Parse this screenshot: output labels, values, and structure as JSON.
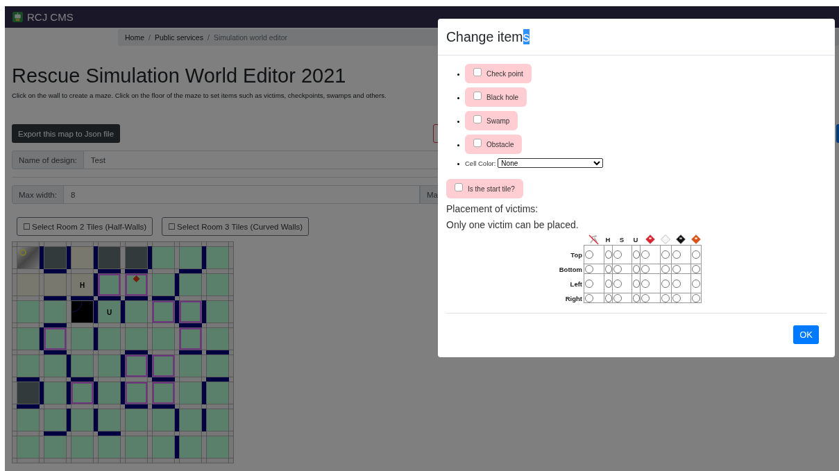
{
  "navbar": {
    "brand": "RCJ CMS"
  },
  "breadcrumb": [
    {
      "label": "Home",
      "active": false
    },
    {
      "label": "Public services",
      "active": false,
      "separator": "/"
    },
    {
      "label": "Simulation world editor",
      "active": true,
      "separator": "/"
    }
  ],
  "title": "Rescue Simulation World Editor 2021",
  "description": "Click on the wall to create a maze. Click on the floor of the maze to set items such as victims, checkpoints, swamps and others.",
  "toolbar": [
    {
      "kind": "dark",
      "label": "Export this map to Json file"
    },
    {
      "kind": "danger-outline"
    },
    {
      "kind": "primary"
    }
  ],
  "design_field": {
    "label": "Name of design:",
    "value": "Test"
  },
  "size_fields": [
    {
      "label": "Max width:",
      "value": "8"
    },
    {
      "label": "Ma"
    }
  ],
  "room_buttons": [
    {
      "icon": "☐",
      "label": "Select Room 2 Tiles (Half-Walls)"
    },
    {
      "icon": "☐",
      "label": "Select Room 3 Tiles (Curved Walls)"
    }
  ],
  "maze": {
    "rows": [
      {
        "tiles": [
          {
            "kind": "start",
            "outlined": false,
            "wall_right": true,
            "wall_bottom": false
          },
          {
            "kind": "dark",
            "outlined": false,
            "wall_right": true,
            "wall_bottom": true
          },
          {
            "kind": "light",
            "outlined": false,
            "wall_right": true,
            "wall_bottom": false
          },
          {
            "kind": "dark",
            "outlined": false,
            "wall_right": false,
            "wall_bottom": true
          },
          {
            "kind": "dark",
            "outlined": false,
            "wall_right": true,
            "wall_bottom": true
          },
          {
            "kind": "green",
            "outlined": false,
            "wall_right": false,
            "wall_bottom": false
          },
          {
            "kind": "green",
            "outlined": false,
            "wall_right": true,
            "wall_bottom": true
          },
          {
            "kind": "green",
            "outlined": false,
            "wall_right": false,
            "wall_bottom": false
          }
        ]
      },
      {
        "tiles": [
          {
            "kind": "light",
            "outlined": false,
            "wall_right": false,
            "wall_bottom": false
          },
          {
            "kind": "light",
            "outlined": false,
            "wall_right": false,
            "wall_bottom": true
          },
          {
            "kind": "light",
            "outlined": false,
            "wall_right": true,
            "wall_bottom": true,
            "marker": {
              "kind": "letter",
              "text": "H"
            }
          },
          {
            "kind": "green",
            "outlined": true,
            "wall_right": false,
            "wall_bottom": true
          },
          {
            "kind": "green",
            "outlined": true,
            "wall_right": false,
            "wall_bottom": true,
            "marker": {
              "kind": "hazmat"
            }
          },
          {
            "kind": "green",
            "outlined": false,
            "wall_right": true,
            "wall_bottom": true
          },
          {
            "kind": "green",
            "outlined": false,
            "wall_right": false,
            "wall_bottom": false
          },
          {
            "kind": "green",
            "outlined": false,
            "wall_right": false,
            "wall_bottom": false
          }
        ]
      },
      {
        "tiles": [
          {
            "kind": "green",
            "outlined": false,
            "wall_right": false,
            "wall_bottom": false
          },
          {
            "kind": "green",
            "outlined": false,
            "wall_right": false,
            "wall_bottom": true
          },
          {
            "kind": "curved",
            "outlined": false,
            "wall_right": true,
            "wall_bottom": false
          },
          {
            "kind": "green",
            "outlined": false,
            "wall_right": true,
            "wall_bottom": false,
            "marker": {
              "kind": "letter",
              "text": "U"
            }
          },
          {
            "kind": "green",
            "outlined": false,
            "wall_right": false,
            "wall_bottom": false
          },
          {
            "kind": "green",
            "outlined": true,
            "wall_right": true,
            "wall_bottom": false
          },
          {
            "kind": "green",
            "outlined": true,
            "wall_right": true,
            "wall_bottom": true
          },
          {
            "kind": "green",
            "outlined": false,
            "wall_right": false,
            "wall_bottom": false
          }
        ]
      },
      {
        "tiles": [
          {
            "kind": "green",
            "outlined": false,
            "wall_right": true,
            "wall_bottom": false
          },
          {
            "kind": "green",
            "outlined": true,
            "wall_right": false,
            "wall_bottom": true
          },
          {
            "kind": "green",
            "outlined": false,
            "wall_right": true,
            "wall_bottom": false
          },
          {
            "kind": "green",
            "outlined": false,
            "wall_right": false,
            "wall_bottom": false
          },
          {
            "kind": "green",
            "outlined": false,
            "wall_right": false,
            "wall_bottom": true
          },
          {
            "kind": "green",
            "outlined": false,
            "wall_right": false,
            "wall_bottom": false
          },
          {
            "kind": "green",
            "outlined": true,
            "wall_right": false,
            "wall_bottom": true
          },
          {
            "kind": "green",
            "outlined": false,
            "wall_right": false,
            "wall_bottom": true
          }
        ]
      },
      {
        "tiles": [
          {
            "kind": "green",
            "outlined": false,
            "wall_right": false,
            "wall_bottom": true
          },
          {
            "kind": "green",
            "outlined": false,
            "wall_right": true,
            "wall_bottom": false
          },
          {
            "kind": "green",
            "outlined": false,
            "wall_right": false,
            "wall_bottom": true
          },
          {
            "kind": "green",
            "outlined": false,
            "wall_right": true,
            "wall_bottom": false
          },
          {
            "kind": "green",
            "outlined": true,
            "wall_right": true,
            "wall_bottom": false
          },
          {
            "kind": "green",
            "outlined": true,
            "wall_right": false,
            "wall_bottom": true
          },
          {
            "kind": "green",
            "outlined": false,
            "wall_right": false,
            "wall_bottom": false
          },
          {
            "kind": "green",
            "outlined": false,
            "wall_right": false,
            "wall_bottom": true
          }
        ]
      },
      {
        "tiles": [
          {
            "kind": "dark",
            "outlined": false,
            "wall_right": true,
            "wall_bottom": true
          },
          {
            "kind": "green",
            "outlined": false,
            "wall_right": true,
            "wall_bottom": false
          },
          {
            "kind": "green",
            "outlined": true,
            "wall_right": true,
            "wall_bottom": false
          },
          {
            "kind": "green",
            "outlined": false,
            "wall_right": true,
            "wall_bottom": false
          },
          {
            "kind": "green",
            "outlined": true,
            "wall_right": false,
            "wall_bottom": true
          },
          {
            "kind": "green",
            "outlined": true,
            "wall_right": false,
            "wall_bottom": true
          },
          {
            "kind": "green",
            "outlined": false,
            "wall_right": true,
            "wall_bottom": false
          },
          {
            "kind": "green",
            "outlined": false,
            "wall_right": false,
            "wall_bottom": false
          }
        ]
      },
      {
        "tiles": [
          {
            "kind": "green",
            "outlined": false,
            "wall_right": false,
            "wall_bottom": false
          },
          {
            "kind": "green",
            "outlined": false,
            "wall_right": true,
            "wall_bottom": true
          },
          {
            "kind": "green",
            "outlined": false,
            "wall_right": true,
            "wall_bottom": false
          },
          {
            "kind": "green",
            "outlined": false,
            "wall_right": false,
            "wall_bottom": true
          },
          {
            "kind": "green",
            "outlined": false,
            "wall_right": false,
            "wall_bottom": false
          },
          {
            "kind": "green",
            "outlined": false,
            "wall_right": true,
            "wall_bottom": false
          },
          {
            "kind": "green",
            "outlined": false,
            "wall_right": true,
            "wall_bottom": false
          },
          {
            "kind": "green",
            "outlined": false,
            "wall_right": false,
            "wall_bottom": false
          }
        ]
      },
      {
        "tiles": [
          {
            "kind": "green",
            "outlined": false,
            "wall_right": false,
            "wall_bottom": false
          },
          {
            "kind": "green",
            "outlined": false,
            "wall_right": false,
            "wall_bottom": false
          },
          {
            "kind": "green",
            "outlined": false,
            "wall_right": false,
            "wall_bottom": false
          },
          {
            "kind": "green",
            "outlined": false,
            "wall_right": false,
            "wall_bottom": false
          },
          {
            "kind": "green",
            "outlined": false,
            "wall_right": false,
            "wall_bottom": false
          },
          {
            "kind": "green",
            "outlined": false,
            "wall_right": true,
            "wall_bottom": false
          },
          {
            "kind": "green",
            "outlined": false,
            "wall_right": false,
            "wall_bottom": false
          },
          {
            "kind": "green",
            "outlined": false,
            "wall_right": false,
            "wall_bottom": false
          }
        ]
      }
    ]
  },
  "modal": {
    "title": "Change item",
    "title_selection": "s",
    "items": [
      {
        "label": "Check point",
        "checked": false
      },
      {
        "label": "Black hole",
        "checked": false
      },
      {
        "label": "Swamp",
        "checked": false
      },
      {
        "label": "Obstacle",
        "checked": false
      }
    ],
    "cell_color": {
      "label": "Cell Color:",
      "value": "None"
    },
    "start_tile": {
      "label": "Is the start tile?",
      "checked": false
    },
    "victims_heading": "Placement of victims:",
    "victims_note": "Only one victim can be placed.",
    "victim_columns": [
      {
        "kind": "harmed"
      },
      {
        "kind": "letter",
        "text": "H"
      },
      {
        "kind": "letter",
        "text": "S"
      },
      {
        "kind": "letter",
        "text": "U"
      },
      {
        "kind": "hazmat",
        "color": "#e0202e"
      },
      {
        "kind": "hazmat",
        "color": "#f4f4f4"
      },
      {
        "kind": "hazmat",
        "color": "#111111"
      },
      {
        "kind": "hazmat",
        "color": "#e05010"
      }
    ],
    "victim_rows": [
      {
        "label": "Top",
        "options": [
          {
            "selected": false
          },
          {
            "selected": false
          },
          {
            "selected": false
          },
          {
            "selected": false
          },
          {
            "selected": false
          },
          {
            "selected": false
          },
          {
            "selected": false
          },
          {
            "selected": false
          }
        ]
      },
      {
        "label": "Bottom",
        "options": [
          {
            "selected": false
          },
          {
            "selected": false
          },
          {
            "selected": false
          },
          {
            "selected": false
          },
          {
            "selected": false
          },
          {
            "selected": false
          },
          {
            "selected": false
          },
          {
            "selected": false
          }
        ]
      },
      {
        "label": "Left",
        "options": [
          {
            "selected": false
          },
          {
            "selected": false
          },
          {
            "selected": false
          },
          {
            "selected": false
          },
          {
            "selected": false
          },
          {
            "selected": false
          },
          {
            "selected": false
          },
          {
            "selected": false
          }
        ]
      },
      {
        "label": "Right",
        "options": [
          {
            "selected": false
          },
          {
            "selected": false
          },
          {
            "selected": false
          },
          {
            "selected": false
          },
          {
            "selected": false
          },
          {
            "selected": false
          },
          {
            "selected": false
          },
          {
            "selected": false
          }
        ]
      }
    ],
    "ok": "OK"
  }
}
